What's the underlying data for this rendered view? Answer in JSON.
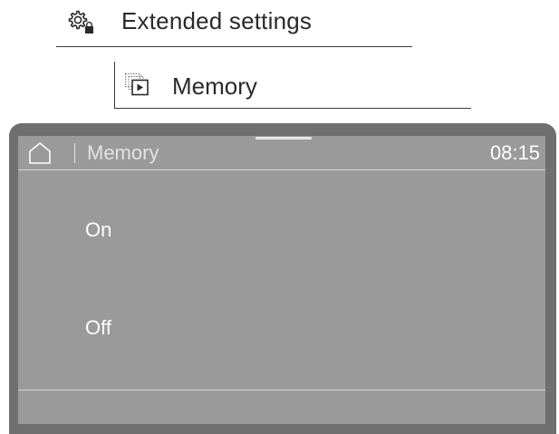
{
  "breadcrumb": {
    "level1": {
      "label": "Extended settings",
      "icon": "gear-lock-icon"
    },
    "level2": {
      "label": "Memory",
      "icon": "memory-play-icon"
    }
  },
  "display": {
    "title": "Memory",
    "time": "08:15",
    "home_icon": "home-icon",
    "options": [
      {
        "label": "On"
      },
      {
        "label": "Off"
      }
    ]
  },
  "colors": {
    "device_frame": "#6f6f6f",
    "screen_background": "#9a9a9a",
    "screen_text": "#ffffff",
    "breadcrumb_text": "#2a2a2a"
  }
}
